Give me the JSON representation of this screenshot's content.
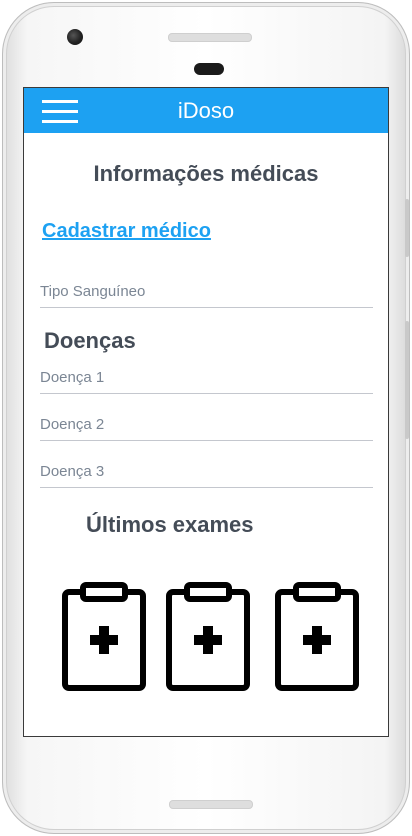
{
  "app": {
    "title": "iDoso"
  },
  "header": {
    "menu_icon": "hamburger-menu-icon"
  },
  "page": {
    "title": "Informações médicas",
    "register_doctor_link": "Cadastrar médico",
    "blood_type": {
      "placeholder": "Tipo Sanguíneo",
      "value": ""
    },
    "diseases": {
      "title": "Doenças",
      "fields": [
        {
          "placeholder": "Doença 1",
          "value": ""
        },
        {
          "placeholder": "Doença 2",
          "value": ""
        },
        {
          "placeholder": "Doença 3",
          "value": ""
        }
      ]
    },
    "exams": {
      "title": "Últimos exames",
      "items": [
        {
          "icon": "medical-clipboard-icon"
        },
        {
          "icon": "medical-clipboard-icon"
        },
        {
          "icon": "medical-clipboard-icon"
        }
      ]
    }
  },
  "colors": {
    "accent": "#1da1f2",
    "heading": "#444c57",
    "placeholder": "#7b8694",
    "divider": "#c4c7ce"
  }
}
